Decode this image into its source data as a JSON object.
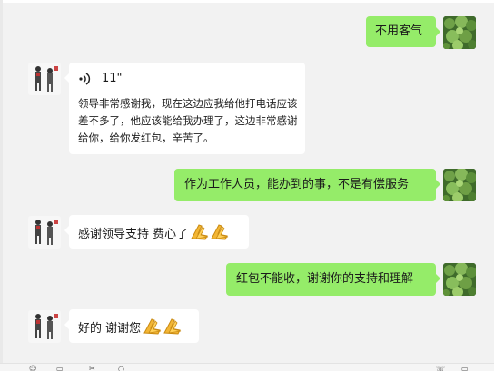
{
  "messages": [
    {
      "side": "out",
      "text": "不用客气"
    },
    {
      "side": "in",
      "type": "voice",
      "duration": "11\"",
      "transcript": "领导非常感谢我，现在这边应我给他打电话应该差不多了，他应该能给我办理了，这边非常感谢给你，给你发红包，辛苦了。"
    },
    {
      "side": "out",
      "text": "作为工作人员，能办到的事，不是有偿服务"
    },
    {
      "side": "in",
      "text": "感谢领导支持 费心了",
      "emoji": "folded-hands"
    },
    {
      "side": "out",
      "text": "红包不能收，谢谢你的支持和理解"
    },
    {
      "side": "in",
      "text": "好的 谢谢您",
      "emoji": "folded-hands"
    }
  ],
  "colors": {
    "background": "#f2f2f2",
    "outgoing_bubble": "#95ec69",
    "incoming_bubble": "#ffffff"
  },
  "icons": {
    "voice": "voice-wave-icon",
    "emoji": "folded-hands-icon",
    "contact_avatar": "two-people-avatar",
    "self_avatar": "green-leaves-avatar"
  }
}
